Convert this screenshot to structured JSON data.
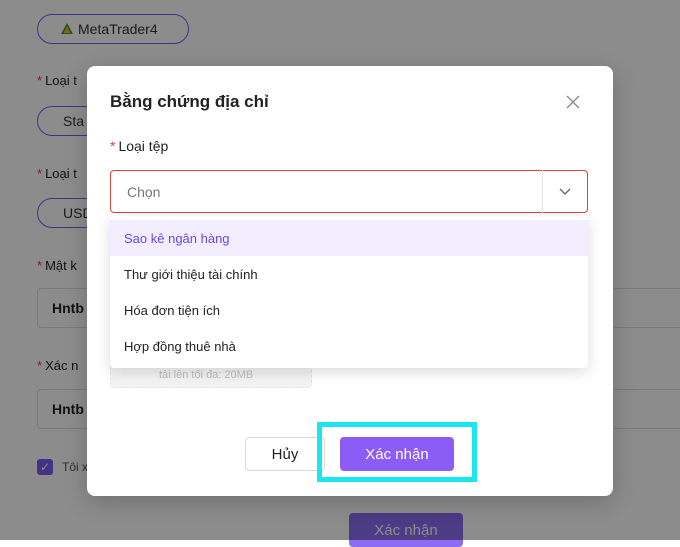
{
  "background": {
    "platform_label": "MetaTrader4",
    "label_1": "Loại t",
    "pill_1": "Sta",
    "label_2": "Loại t",
    "pill_2": "USD",
    "label_3": "Mật k",
    "input_1_value": "Hntb",
    "label_4": "Xác n",
    "input_2_value": "Hntb",
    "check_label": "Tôi x",
    "submit_label": "Xác nhận",
    "required_mark": "*"
  },
  "modal": {
    "title": "Bằng chứng địa chỉ",
    "close_icon": "close-icon",
    "field_label": "Loại tệp",
    "required_mark": "*",
    "select_placeholder": "Chọn",
    "upload_hint": "tải lên tối đa: 20MB",
    "options": [
      {
        "label": "Sao kê ngân hàng",
        "active": true
      },
      {
        "label": "Thư giới thiệu tài chính",
        "active": false
      },
      {
        "label": "Hóa đơn tiện ích",
        "active": false
      },
      {
        "label": "Hợp đồng thuê nhà",
        "active": false
      }
    ],
    "cancel_label": "Hủy",
    "confirm_label": "Xác nhận"
  },
  "colors": {
    "accent": "#8b5cf6",
    "required": "#e0413b",
    "highlight": "#19e6ee"
  }
}
